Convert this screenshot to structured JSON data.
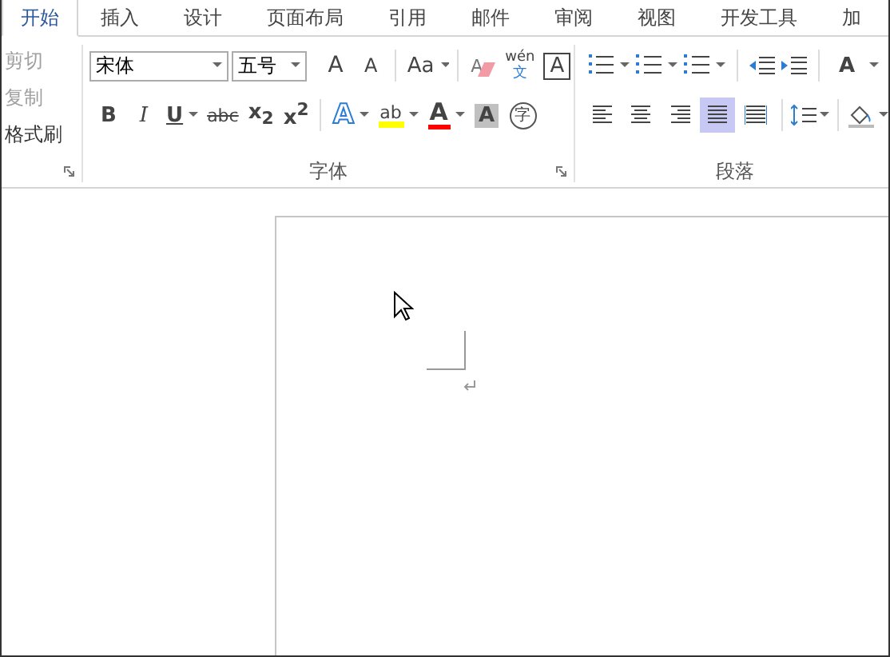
{
  "tabs": [
    {
      "label": "开始",
      "selected": true
    },
    {
      "label": "插入",
      "selected": false
    },
    {
      "label": "设计",
      "selected": false
    },
    {
      "label": "页面布局",
      "selected": false
    },
    {
      "label": "引用",
      "selected": false
    },
    {
      "label": "邮件",
      "selected": false
    },
    {
      "label": "审阅",
      "selected": false
    },
    {
      "label": "视图",
      "selected": false
    },
    {
      "label": "开发工具",
      "selected": false
    },
    {
      "label": "加",
      "selected": false
    }
  ],
  "clipboard": {
    "items": [
      {
        "label": "剪切",
        "disabled": true
      },
      {
        "label": "复制",
        "disabled": true
      },
      {
        "label": "格式刷",
        "disabled": false
      }
    ]
  },
  "font": {
    "name": "宋体",
    "size": "五号",
    "grow": "A",
    "shrink": "A",
    "change_case": "Aa",
    "clear_format": "A",
    "phonetic": {
      "top": "wén",
      "bottom": "文"
    },
    "border": "A",
    "format": [
      {
        "kind": "bold",
        "label": "B",
        "dropdown": false
      },
      {
        "kind": "italic",
        "label": "I",
        "dropdown": false
      },
      {
        "kind": "underline",
        "label": "U",
        "dropdown": true
      },
      {
        "kind": "strike",
        "label": "abc",
        "dropdown": false
      },
      {
        "kind": "sub",
        "label": "x$_{2}$",
        "dropdown": false
      },
      {
        "kind": "sup",
        "label": "x$^{2}$",
        "dropdown": false
      }
    ],
    "effects": [
      {
        "kind": "text_effect",
        "label": "A",
        "dropdown": true
      },
      {
        "kind": "highlight",
        "label": "ab",
        "color": "#ffff00",
        "dropdown": true
      },
      {
        "kind": "font_color",
        "label": "A",
        "color": "#ff0000",
        "dropdown": true
      },
      {
        "kind": "shading",
        "label": "A",
        "dropdown": false
      },
      {
        "kind": "enclose",
        "label": "字",
        "dropdown": false
      }
    ],
    "group_label": "字体"
  },
  "paragraph": {
    "layout": "A",
    "alignment": [
      {
        "kind": "left",
        "selected": false
      },
      {
        "kind": "center",
        "selected": false
      },
      {
        "kind": "right",
        "selected": false
      },
      {
        "kind": "justify",
        "selected": true
      },
      {
        "kind": "distributed",
        "selected": false
      }
    ],
    "group_label": "段落"
  }
}
